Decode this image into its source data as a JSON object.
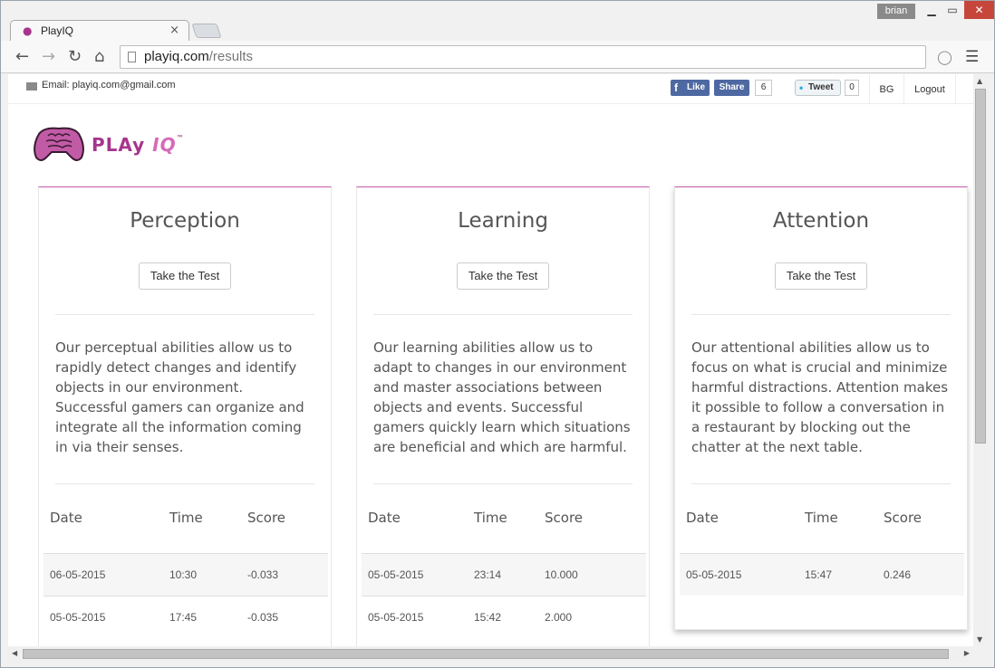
{
  "browser": {
    "tab_title": "PlayIQ",
    "tab_close": "×",
    "user": "brian",
    "url_host": "playiq.com",
    "url_path": "/results",
    "win_min": "▁",
    "win_max": "▭",
    "win_close": "✕",
    "icons": {
      "back": "back-arrow-icon",
      "forward": "forward-arrow-icon",
      "reload": "reload-icon",
      "home": "home-icon",
      "menu": "hamburger-menu-icon",
      "shield": "shield-icon"
    }
  },
  "infobar": {
    "email": "Email: playiq.com@gmail.com",
    "fb_like": "Like",
    "fb_share": "Share",
    "fb_count": "6",
    "tweet": "Tweet",
    "tweet_count": "0",
    "lang": "BG",
    "logout": "Logout"
  },
  "logo": {
    "main": "PLAy ",
    "accent": "IQ",
    "tm": "™"
  },
  "colors": {
    "accent": "#c25ba6",
    "logo": "#a7358d",
    "text": "#555555"
  },
  "cards": [
    {
      "title": "Perception",
      "button": "Take the Test",
      "description": "Our perceptual abilities allow us to rapidly detect changes and identify objects in our environment. Successful gamers can organize and integrate all the information coming in via their senses.",
      "headers": [
        "Date",
        "Time",
        "Score"
      ],
      "rows": [
        [
          "06-05-2015",
          "10:30",
          "-0.033"
        ],
        [
          "05-05-2015",
          "17:45",
          "-0.035"
        ]
      ]
    },
    {
      "title": "Learning",
      "button": "Take the Test",
      "description": "Our learning abilities allow us to adapt to changes in our environment and master associations between objects and events. Successful gamers quickly learn which situations are beneficial and which are harmful.",
      "headers": [
        "Date",
        "Time",
        "Score"
      ],
      "rows": [
        [
          "05-05-2015",
          "23:14",
          "10.000"
        ],
        [
          "05-05-2015",
          "15:42",
          "2.000"
        ]
      ]
    },
    {
      "title": "Attention",
      "button": "Take the Test",
      "description": "Our attentional abilities allow us to focus on what is crucial and minimize harmful distractions. Attention makes it possible to follow a conversation in a restaurant by blocking out the chatter at the next table.",
      "headers": [
        "Date",
        "Time",
        "Score"
      ],
      "rows": [
        [
          "05-05-2015",
          "15:47",
          "0.246"
        ]
      ]
    }
  ]
}
